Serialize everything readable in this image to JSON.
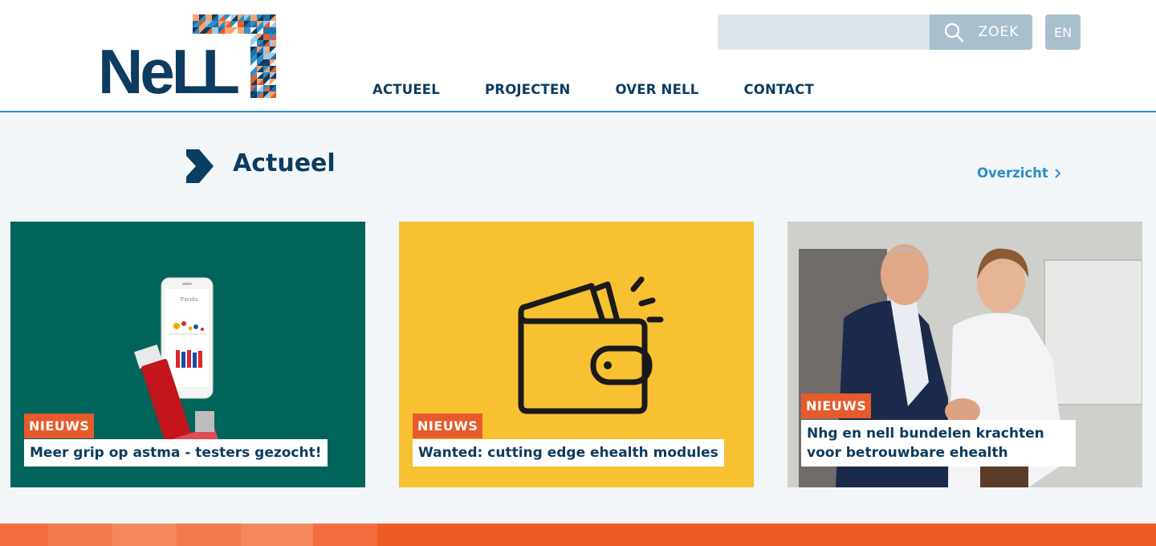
{
  "brand": {
    "logo_text_1": "Ne",
    "logo_text_2": "LL",
    "navy": "#0c3c60",
    "accent_blue": "#2b8fc7",
    "accent_orange": "#e65a2b"
  },
  "header": {
    "search": {
      "placeholder": "",
      "button_label": "ZOEK",
      "icon": "search-icon"
    },
    "language_button": "EN",
    "nav": [
      {
        "label": "ACTUEEL"
      },
      {
        "label": "PROJECTEN"
      },
      {
        "label": "OVER NELL"
      },
      {
        "label": "CONTACT"
      }
    ]
  },
  "section": {
    "title": "Actueel",
    "overview_link": "Overzicht",
    "icon": "chevron-right-icon"
  },
  "cards": [
    {
      "badge": "NIEUWS",
      "title": "Meer grip op astma - testers gezocht!",
      "image": "phone-inhaler-illustration",
      "background": "#00645a"
    },
    {
      "badge": "NIEUWS",
      "title": "Wanted: cutting edge ehealth modules",
      "image": "wallet-icon",
      "background": "#f7c131"
    },
    {
      "badge": "NIEUWS",
      "title": "Nhg en nell bundelen krachten voor betrouwbare ehealth",
      "image": "handshake-photo",
      "background": "#d8d8d4"
    }
  ]
}
